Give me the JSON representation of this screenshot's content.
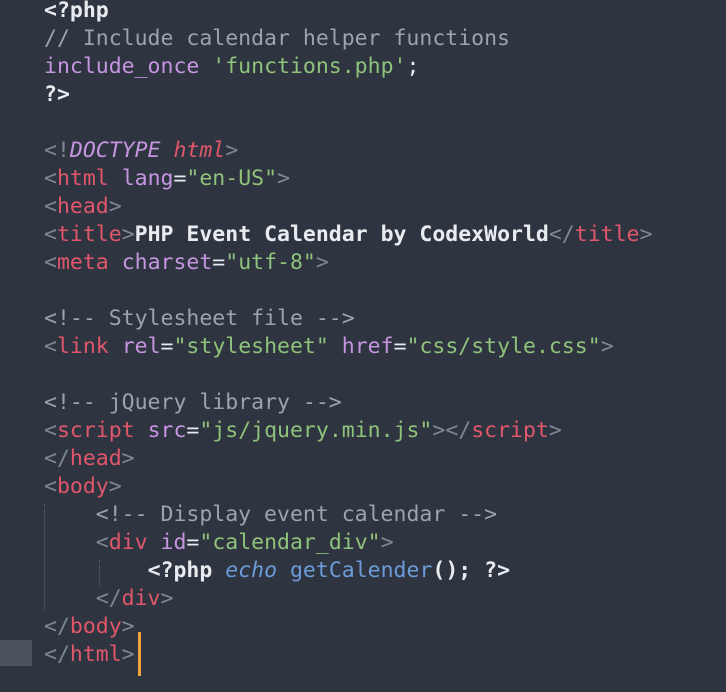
{
  "editor": {
    "lines": [
      {
        "tokens": [
          {
            "t": "<?php",
            "c": "t-bold"
          }
        ]
      },
      {
        "tokens": [
          {
            "t": "// Include calendar helper functions",
            "c": "t-cmt"
          }
        ]
      },
      {
        "tokens": [
          {
            "t": "include_once",
            "c": "t-fn"
          },
          {
            "t": " ",
            "c": "t-text"
          },
          {
            "t": "'functions.php'",
            "c": "t-str"
          },
          {
            "t": ";",
            "c": "t-text"
          }
        ]
      },
      {
        "tokens": [
          {
            "t": "?>",
            "c": "t-bold"
          }
        ]
      },
      {
        "tokens": []
      },
      {
        "tokens": [
          {
            "t": "<!",
            "c": "t-punct"
          },
          {
            "t": "DOCTYPE",
            "c": "t-doct"
          },
          {
            "t": " ",
            "c": "t-text"
          },
          {
            "t": "html",
            "c": "t-docth"
          },
          {
            "t": ">",
            "c": "t-punct"
          }
        ]
      },
      {
        "tokens": [
          {
            "t": "<",
            "c": "t-punct"
          },
          {
            "t": "html",
            "c": "t-tag"
          },
          {
            "t": " ",
            "c": "t-text"
          },
          {
            "t": "lang",
            "c": "t-attr"
          },
          {
            "t": "=",
            "c": "t-text"
          },
          {
            "t": "\"en-US\"",
            "c": "t-str"
          },
          {
            "t": ">",
            "c": "t-punct"
          }
        ]
      },
      {
        "tokens": [
          {
            "t": "<",
            "c": "t-punct"
          },
          {
            "t": "head",
            "c": "t-tag"
          },
          {
            "t": ">",
            "c": "t-punct"
          }
        ]
      },
      {
        "tokens": [
          {
            "t": "<",
            "c": "t-punct"
          },
          {
            "t": "title",
            "c": "t-tag"
          },
          {
            "t": ">",
            "c": "t-punct"
          },
          {
            "t": "PHP Event Calendar by CodexWorld",
            "c": "t-bold"
          },
          {
            "t": "</",
            "c": "t-punct"
          },
          {
            "t": "title",
            "c": "t-tag"
          },
          {
            "t": ">",
            "c": "t-punct"
          }
        ]
      },
      {
        "tokens": [
          {
            "t": "<",
            "c": "t-punct"
          },
          {
            "t": "meta",
            "c": "t-tag"
          },
          {
            "t": " ",
            "c": "t-text"
          },
          {
            "t": "charset",
            "c": "t-attr"
          },
          {
            "t": "=",
            "c": "t-text"
          },
          {
            "t": "\"utf-8\"",
            "c": "t-str"
          },
          {
            "t": ">",
            "c": "t-punct"
          }
        ]
      },
      {
        "tokens": []
      },
      {
        "tokens": [
          {
            "t": "<!-- Stylesheet file -->",
            "c": "t-cmt"
          }
        ]
      },
      {
        "tokens": [
          {
            "t": "<",
            "c": "t-punct"
          },
          {
            "t": "link",
            "c": "t-tag"
          },
          {
            "t": " ",
            "c": "t-text"
          },
          {
            "t": "rel",
            "c": "t-attr"
          },
          {
            "t": "=",
            "c": "t-text"
          },
          {
            "t": "\"stylesheet\"",
            "c": "t-str"
          },
          {
            "t": " ",
            "c": "t-text"
          },
          {
            "t": "href",
            "c": "t-attr"
          },
          {
            "t": "=",
            "c": "t-text"
          },
          {
            "t": "\"css/style.css\"",
            "c": "t-str"
          },
          {
            "t": ">",
            "c": "t-punct"
          }
        ]
      },
      {
        "tokens": []
      },
      {
        "tokens": [
          {
            "t": "<!-- jQuery library -->",
            "c": "t-cmt"
          }
        ]
      },
      {
        "tokens": [
          {
            "t": "<",
            "c": "t-punct"
          },
          {
            "t": "script",
            "c": "t-tag"
          },
          {
            "t": " ",
            "c": "t-text"
          },
          {
            "t": "src",
            "c": "t-attr"
          },
          {
            "t": "=",
            "c": "t-text"
          },
          {
            "t": "\"js/jquery.min.js\"",
            "c": "t-str"
          },
          {
            "t": "></",
            "c": "t-punct"
          },
          {
            "t": "script",
            "c": "t-tag"
          },
          {
            "t": ">",
            "c": "t-punct"
          }
        ]
      },
      {
        "tokens": [
          {
            "t": "</",
            "c": "t-punct"
          },
          {
            "t": "head",
            "c": "t-tag"
          },
          {
            "t": ">",
            "c": "t-punct"
          }
        ]
      },
      {
        "tokens": [
          {
            "t": "<",
            "c": "t-punct"
          },
          {
            "t": "body",
            "c": "t-tag"
          },
          {
            "t": ">",
            "c": "t-punct"
          }
        ]
      },
      {
        "tokens": [
          {
            "t": "    ",
            "c": "t-text"
          },
          {
            "t": "<!-- Display event calendar -->",
            "c": "t-cmt"
          }
        ]
      },
      {
        "tokens": [
          {
            "t": "    ",
            "c": "t-text"
          },
          {
            "t": "<",
            "c": "t-punct"
          },
          {
            "t": "div",
            "c": "t-tag"
          },
          {
            "t": " ",
            "c": "t-text"
          },
          {
            "t": "id",
            "c": "t-attr"
          },
          {
            "t": "=",
            "c": "t-text"
          },
          {
            "t": "\"calendar_div\"",
            "c": "t-str"
          },
          {
            "t": ">",
            "c": "t-punct"
          }
        ]
      },
      {
        "tokens": [
          {
            "t": "        ",
            "c": "t-text"
          },
          {
            "t": "<?php",
            "c": "t-bold"
          },
          {
            "t": " ",
            "c": "t-text"
          },
          {
            "t": "echo",
            "c": "t-ital"
          },
          {
            "t": " ",
            "c": "t-text"
          },
          {
            "t": "getCalender",
            "c": "t-call"
          },
          {
            "t": "(); ",
            "c": "t-bold"
          },
          {
            "t": "?>",
            "c": "t-bold"
          }
        ]
      },
      {
        "tokens": [
          {
            "t": "    ",
            "c": "t-text"
          },
          {
            "t": "</",
            "c": "t-punct"
          },
          {
            "t": "div",
            "c": "t-tag"
          },
          {
            "t": ">",
            "c": "t-punct"
          }
        ]
      },
      {
        "tokens": [
          {
            "t": "</",
            "c": "t-punct"
          },
          {
            "t": "body",
            "c": "t-tag"
          },
          {
            "t": ">",
            "c": "t-punct"
          }
        ]
      },
      {
        "tokens": [
          {
            "t": "</",
            "c": "t-punct"
          },
          {
            "t": "html",
            "c": "t-tag"
          },
          {
            "t": ">",
            "c": "t-punct"
          }
        ]
      }
    ],
    "colors": {
      "background": "#2f3540",
      "cursor": "#f0a43a",
      "tag": "#e0566a",
      "attribute": "#c595e0",
      "string": "#8fc27a",
      "comment": "#9aa3ae"
    }
  }
}
